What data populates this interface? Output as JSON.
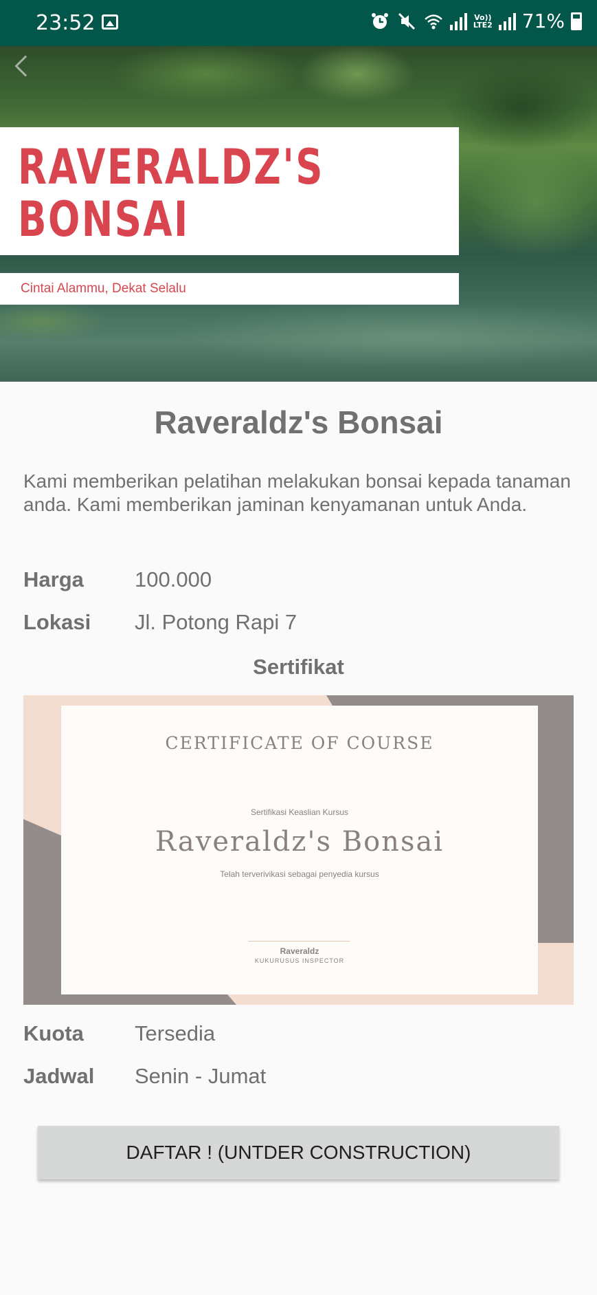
{
  "status_bar": {
    "time": "23:52",
    "lte_label_top": "Vo))",
    "lte_label_bottom": "LTE2",
    "battery": "71%"
  },
  "hero": {
    "title_line1": "RAVERALDZ'S",
    "title_line2": "BONSAI",
    "tagline": "Cintai Alammu, Dekat Selalu"
  },
  "course": {
    "title": "Raveraldz's Bonsai",
    "description": "Kami memberikan pelatihan melakukan bonsai kepada tanaman anda. Kami memberikan jaminan kenyamanan untuk Anda.",
    "price_label": "Harga",
    "price_value": "100.000",
    "location_label": "Lokasi",
    "location_value": "Jl. Potong Rapi 7",
    "certificate_label": "Sertifikat",
    "quota_label": "Kuota",
    "quota_value": "Tersedia",
    "schedule_label": "Jadwal",
    "schedule_value": "Senin - Jumat"
  },
  "certificate": {
    "heading": "CERTIFICATE OF COURSE",
    "subheading": "Sertifikasi Keaslian Kursus",
    "name": "Raveraldz's Bonsai",
    "verification": "Telah terverivikasi sebagai penyedia kursus",
    "signer": "Raveraldz",
    "signer_role": "KUKURUSUS INSPECTOR"
  },
  "register_button_label": "DAFTAR ! (UNTDER CONSTRUCTION)",
  "colors": {
    "status_bar": "#03574a",
    "hero_title": "#d9454f",
    "text_gray": "#707070",
    "button_bg": "#d6d7d7"
  }
}
